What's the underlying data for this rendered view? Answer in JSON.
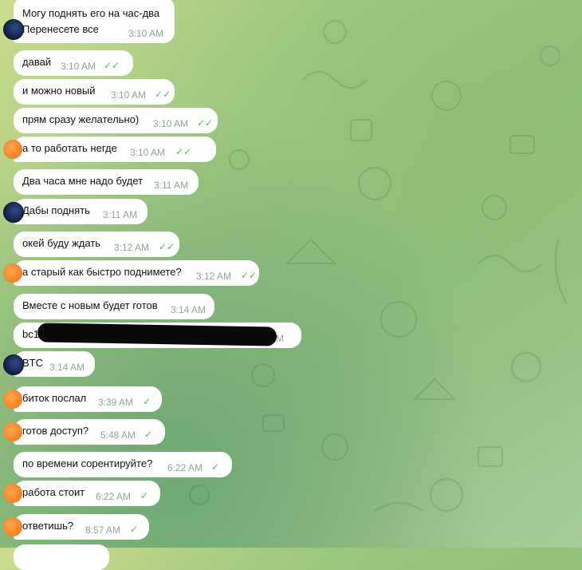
{
  "messages": [
    {
      "id": "m1",
      "line1": "Могу поднять его на час-два",
      "line2": "Перенесете все",
      "time": "3:10 AM",
      "check": ""
    },
    {
      "id": "m2",
      "text": "давай",
      "time": "3:10 AM",
      "check": "✓✓"
    },
    {
      "id": "m3",
      "text": "и можно новый",
      "time": "3:10 AM",
      "check": "✓✓"
    },
    {
      "id": "m4",
      "text": "прям сразу желательно)",
      "time": "3:10 AM",
      "check": "✓✓"
    },
    {
      "id": "m5",
      "text": "а то работать негде",
      "time": "3:10 AM",
      "check": "✓✓"
    },
    {
      "id": "m6",
      "text": "Два часа мне надо будет",
      "time": "3:11 AM",
      "check": ""
    },
    {
      "id": "m7",
      "text": "Дабы поднять",
      "time": "3:11 AM",
      "check": ""
    },
    {
      "id": "m8",
      "text": "окей буду ждать",
      "time": "3:12 AM",
      "check": "✓✓"
    },
    {
      "id": "m9",
      "text": "а старый как быстро поднимете?",
      "time": "3:12 AM",
      "check": "✓✓"
    },
    {
      "id": "m10",
      "text": "Вместе с новым будет готов",
      "time": "3:14 AM",
      "check": ""
    },
    {
      "id": "m11",
      "text": "bc1",
      "time": "3:14 AM",
      "check": ""
    },
    {
      "id": "m12",
      "text": "BTC",
      "time": "3:14 AM",
      "check": ""
    },
    {
      "id": "m13",
      "text": "биток послал",
      "time": "3:39 AM",
      "check": "✓"
    },
    {
      "id": "m14",
      "text": "готов доступ?",
      "time": "5:48 AM",
      "check": "✓"
    },
    {
      "id": "m15",
      "text": "по времени сорентируйте?",
      "time": "6:22 AM",
      "check": "✓"
    },
    {
      "id": "m16",
      "text": "работа стоит",
      "time": "6:22 AM",
      "check": "✓"
    },
    {
      "id": "m17",
      "text": "ответишь?",
      "time": "8:57 AM",
      "check": "✓"
    }
  ],
  "colors": {
    "bubble": "#ffffff",
    "time": "#8fa68f",
    "check": "#5cb85c",
    "avatar_blue": "#1a2d5c",
    "avatar_orange": "#f4861f"
  },
  "icons": {
    "avatar_blue": "round-logo-avatar",
    "avatar_orange": "orange-avatar"
  }
}
